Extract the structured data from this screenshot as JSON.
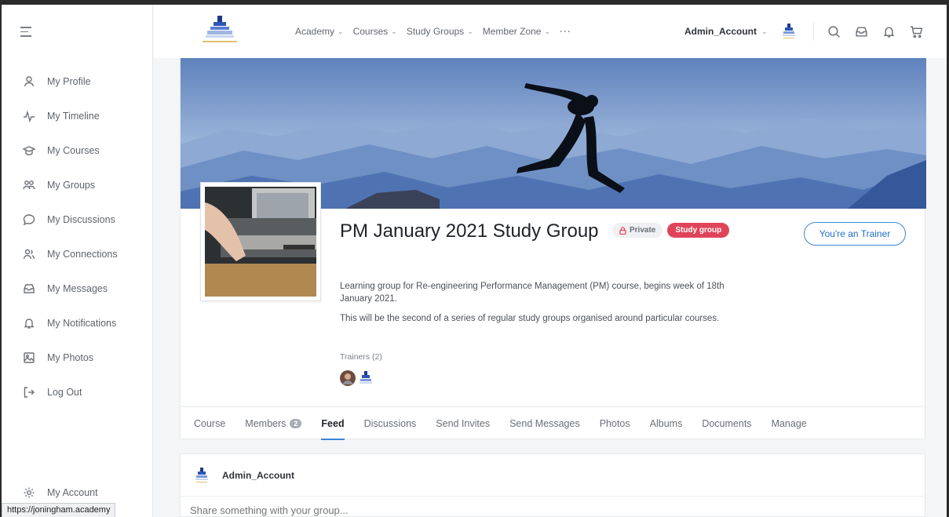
{
  "sidebar": {
    "items": [
      {
        "label": "My Profile",
        "icon": "user-icon"
      },
      {
        "label": "My Timeline",
        "icon": "activity-icon"
      },
      {
        "label": "My Courses",
        "icon": "graduation-cap-icon"
      },
      {
        "label": "My Groups",
        "icon": "groups-icon"
      },
      {
        "label": "My Discussions",
        "icon": "chat-bubble-icon"
      },
      {
        "label": "My Connections",
        "icon": "connections-icon"
      },
      {
        "label": "My Messages",
        "icon": "inbox-icon"
      },
      {
        "label": "My Notifications",
        "icon": "bell-icon"
      },
      {
        "label": "My Photos",
        "icon": "photo-icon"
      },
      {
        "label": "Log Out",
        "icon": "logout-icon"
      }
    ],
    "account_label": "My Account"
  },
  "status_url": "https://joningham.academy",
  "header": {
    "menu": [
      {
        "label": "Academy"
      },
      {
        "label": "Courses"
      },
      {
        "label": "Study Groups"
      },
      {
        "label": "Member Zone"
      }
    ],
    "more": "···",
    "user_name": "Admin_Account"
  },
  "group": {
    "title": "PM January 2021 Study Group",
    "privacy_badge": "Private",
    "type_badge": "Study group",
    "role_button": "You're an Trainer",
    "description": [
      "Learning group for Re-engineering Performance Management (PM) course, begins week of 18th January 2021.",
      "This will be the second of a series of regular study groups organised around particular courses."
    ],
    "trainers_label": "Trainers (2)"
  },
  "tabs": [
    {
      "label": "Course"
    },
    {
      "label": "Members",
      "count": "2"
    },
    {
      "label": "Feed"
    },
    {
      "label": "Discussions"
    },
    {
      "label": "Send Invites"
    },
    {
      "label": "Send Messages"
    },
    {
      "label": "Photos"
    },
    {
      "label": "Albums"
    },
    {
      "label": "Documents"
    },
    {
      "label": "Manage"
    }
  ],
  "active_tab": "Feed",
  "composer": {
    "user_name": "Admin_Account",
    "placeholder": "Share something with your group..."
  },
  "colors": {
    "accent": "#3b86d6",
    "study_badge": "#e0445a",
    "cover_sky": "#6d8fc4"
  }
}
